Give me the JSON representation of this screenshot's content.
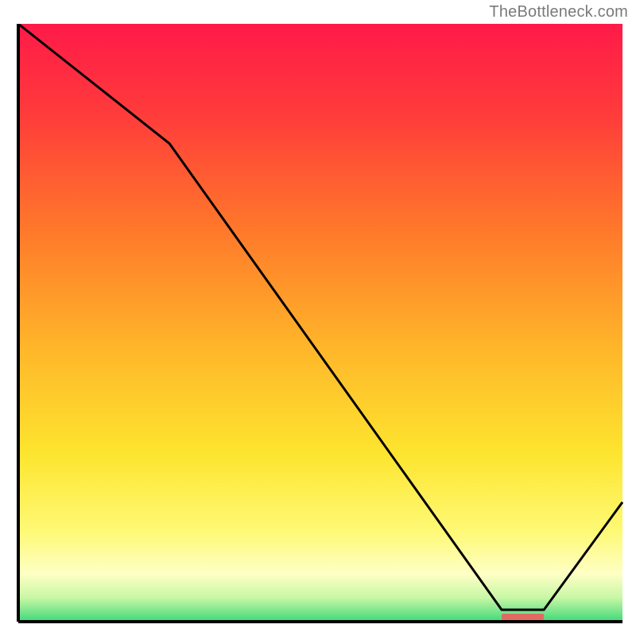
{
  "attribution": "TheBottleneck.com",
  "chart_data": {
    "type": "line",
    "title": "",
    "xlabel": "",
    "ylabel": "",
    "xlim": [
      0,
      100
    ],
    "ylim": [
      0,
      100
    ],
    "x": [
      0,
      25,
      80,
      87,
      100
    ],
    "values": [
      100,
      80,
      2,
      2,
      20
    ],
    "marker_band": {
      "x_start": 80,
      "x_end": 87,
      "color": "#e06a63"
    },
    "background_gradient": {
      "stops": [
        {
          "offset": 0.0,
          "color": "#ff1a49"
        },
        {
          "offset": 0.15,
          "color": "#ff3b3b"
        },
        {
          "offset": 0.35,
          "color": "#ff7a2a"
        },
        {
          "offset": 0.55,
          "color": "#ffb82a"
        },
        {
          "offset": 0.72,
          "color": "#fde52f"
        },
        {
          "offset": 0.85,
          "color": "#fef976"
        },
        {
          "offset": 0.92,
          "color": "#feffc5"
        },
        {
          "offset": 0.96,
          "color": "#c8f7a5"
        },
        {
          "offset": 1.0,
          "color": "#3fd87a"
        }
      ]
    },
    "axis_color": "#000000",
    "line_color": "#000000",
    "line_width": 3
  }
}
